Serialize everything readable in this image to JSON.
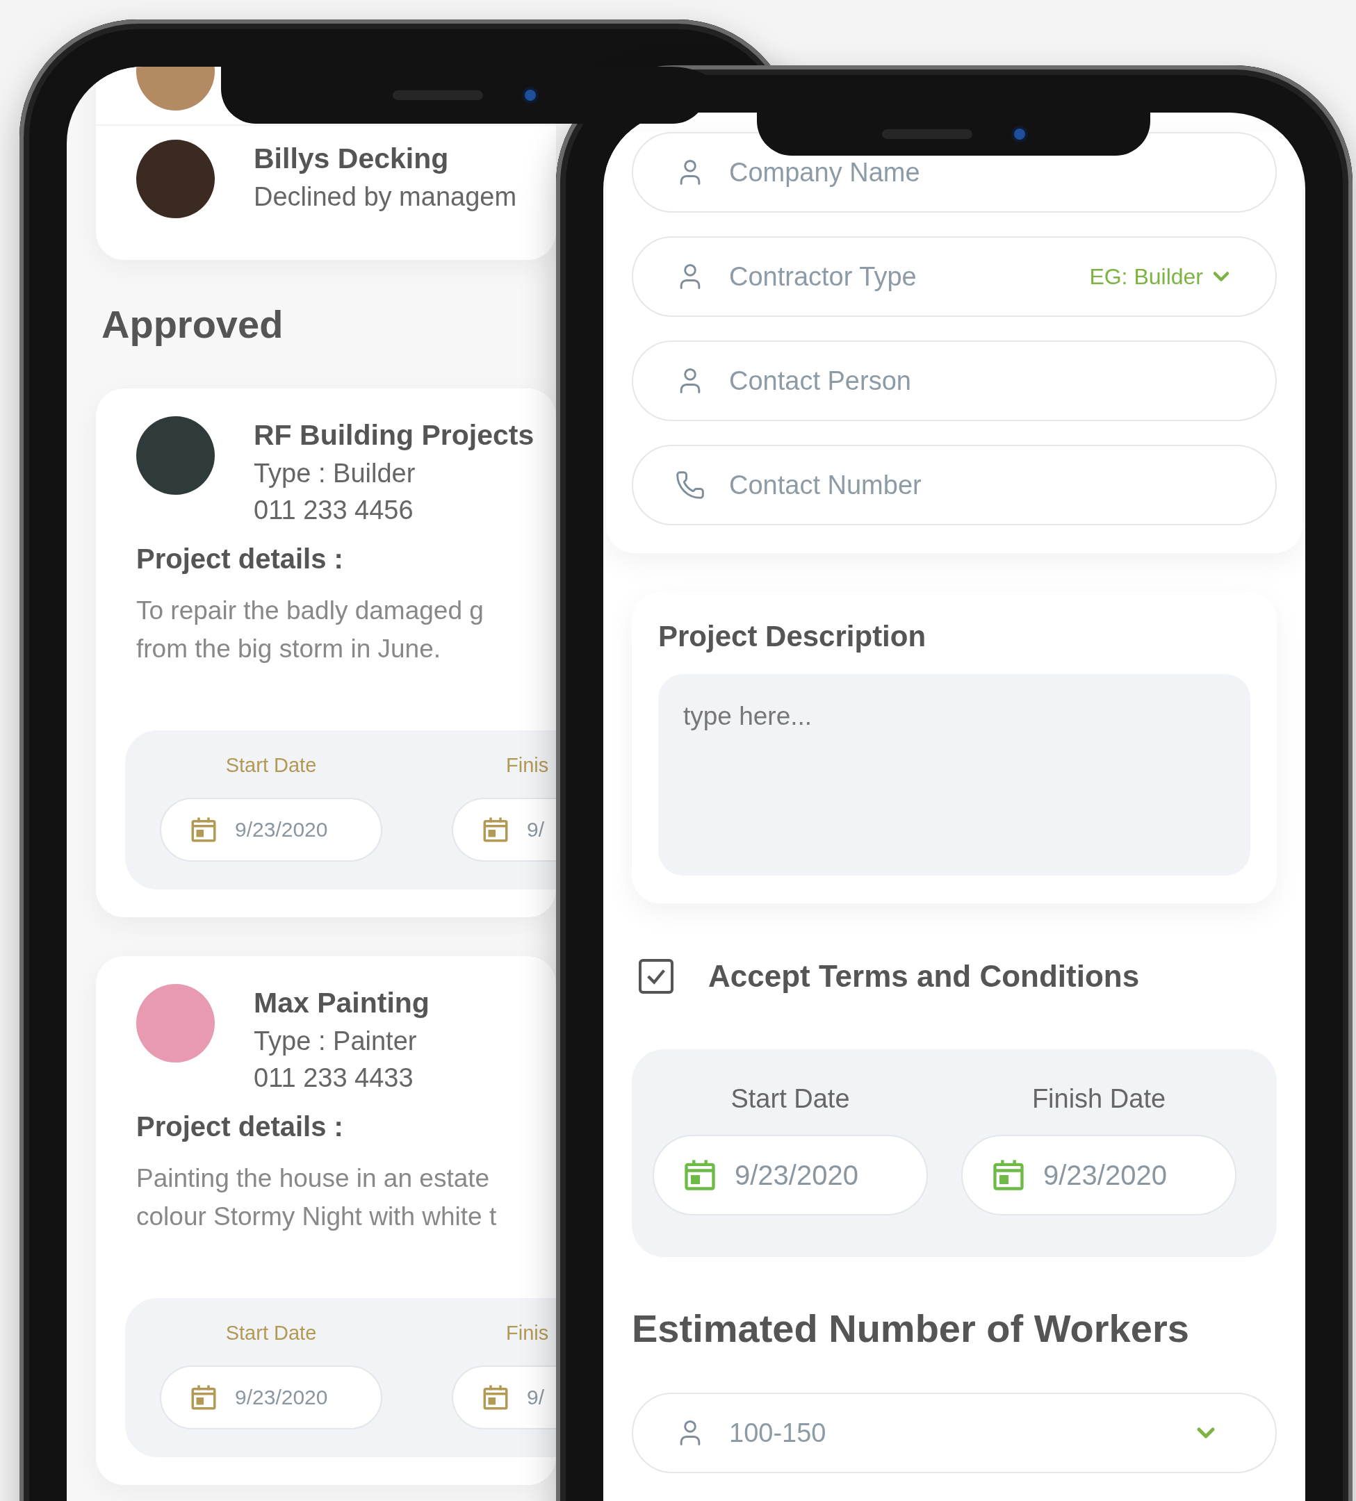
{
  "left": {
    "requests": [
      {
        "name": "Billys Decking",
        "status": "Declined by managem"
      }
    ],
    "section_title": "Approved",
    "approved": [
      {
        "name": "RF Building Projects",
        "type": "Type : Builder",
        "phone": "011 233 4456",
        "details_label": "Project details :",
        "details_lines": [
          "To repair the badly damaged g",
          "from the big storm in June."
        ],
        "dates": [
          {
            "label": "Start Date",
            "value": "9/23/2020"
          },
          {
            "label": "Finis",
            "value": "9/"
          }
        ]
      },
      {
        "name": "Max Painting",
        "type": "Type : Painter",
        "phone": "011 233 4433",
        "details_label": "Project details :",
        "details_lines": [
          "Painting the house in an estate",
          "colour Stormy Night with white t"
        ],
        "dates": [
          {
            "label": "Start Date",
            "value": "9/23/2020"
          },
          {
            "label": "Finis",
            "value": "9/"
          }
        ]
      }
    ]
  },
  "right": {
    "fields": [
      {
        "kind": "person",
        "placeholder": "Company Name"
      },
      {
        "kind": "select",
        "placeholder": "Contractor Type",
        "option": "EG: Builder"
      },
      {
        "kind": "person",
        "placeholder": "Contact Person"
      },
      {
        "kind": "phone",
        "placeholder": "Contact Number"
      }
    ],
    "description": {
      "title": "Project Description",
      "placeholder": "type here..."
    },
    "terms": {
      "label": "Accept Terms and Conditions",
      "checked": true
    },
    "dates": [
      {
        "label": "Start Date",
        "value": "9/23/2020"
      },
      {
        "label": "Finish Date",
        "value": "9/23/2020"
      }
    ],
    "workers": {
      "title": "Estimated Number of Workers",
      "value": "100-150"
    }
  }
}
